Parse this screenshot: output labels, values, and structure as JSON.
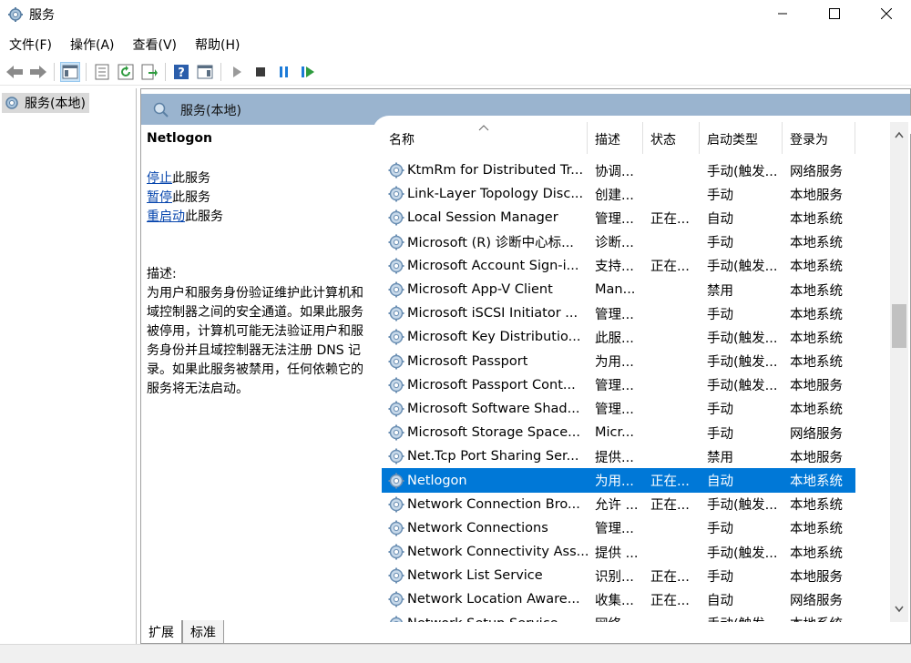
{
  "window": {
    "title": "服务"
  },
  "menu": [
    "文件(F)",
    "操作(A)",
    "查看(V)",
    "帮助(H)"
  ],
  "tree": {
    "root_label": "服务(本地)"
  },
  "panel": {
    "header_title": "服务(本地)"
  },
  "selected_service": {
    "name": "Netlogon",
    "actions": [
      {
        "link": "停止",
        "suffix": "此服务"
      },
      {
        "link": "暂停",
        "suffix": "此服务"
      },
      {
        "link": "重启动",
        "suffix": "此服务"
      }
    ],
    "description_label": "描述:",
    "description": "为用户和服务身份验证维护此计算机和域控制器之间的安全通道。如果此服务被停用，计算机可能无法验证用户和服务身份并且域控制器无法注册 DNS 记录。如果此服务被禁用，任何依赖它的服务将无法启动。"
  },
  "columns": [
    "名称",
    "描述",
    "状态",
    "启动类型",
    "登录为"
  ],
  "rows": [
    {
      "name": "KtmRm for Distributed Tr...",
      "desc": "协调...",
      "status": "",
      "startup": "手动(触发...",
      "logon": "网络服务"
    },
    {
      "name": "Link-Layer Topology Disc...",
      "desc": "创建...",
      "status": "",
      "startup": "手动",
      "logon": "本地服务"
    },
    {
      "name": "Local Session Manager",
      "desc": "管理...",
      "status": "正在...",
      "startup": "自动",
      "logon": "本地系统"
    },
    {
      "name": "Microsoft (R) 诊断中心标...",
      "desc": "诊断...",
      "status": "",
      "startup": "手动",
      "logon": "本地系统"
    },
    {
      "name": "Microsoft Account Sign-i...",
      "desc": "支持...",
      "status": "正在...",
      "startup": "手动(触发...",
      "logon": "本地系统"
    },
    {
      "name": "Microsoft App-V Client",
      "desc": "Man...",
      "status": "",
      "startup": "禁用",
      "logon": "本地系统"
    },
    {
      "name": "Microsoft iSCSI Initiator ...",
      "desc": "管理...",
      "status": "",
      "startup": "手动",
      "logon": "本地系统"
    },
    {
      "name": "Microsoft Key Distributio...",
      "desc": "此服...",
      "status": "",
      "startup": "手动(触发...",
      "logon": "本地系统"
    },
    {
      "name": "Microsoft Passport",
      "desc": "为用...",
      "status": "",
      "startup": "手动(触发...",
      "logon": "本地系统"
    },
    {
      "name": "Microsoft Passport Cont...",
      "desc": "管理...",
      "status": "",
      "startup": "手动(触发...",
      "logon": "本地服务"
    },
    {
      "name": "Microsoft Software Shad...",
      "desc": "管理...",
      "status": "",
      "startup": "手动",
      "logon": "本地系统"
    },
    {
      "name": "Microsoft Storage Space...",
      "desc": "Micr...",
      "status": "",
      "startup": "手动",
      "logon": "网络服务"
    },
    {
      "name": "Net.Tcp Port Sharing Ser...",
      "desc": "提供...",
      "status": "",
      "startup": "禁用",
      "logon": "本地服务"
    },
    {
      "name": "Netlogon",
      "desc": "为用...",
      "status": "正在...",
      "startup": "自动",
      "logon": "本地系统",
      "selected": true
    },
    {
      "name": "Network Connection Bro...",
      "desc": "允许 ...",
      "status": "正在...",
      "startup": "手动(触发...",
      "logon": "本地系统"
    },
    {
      "name": "Network Connections",
      "desc": "管理...",
      "status": "",
      "startup": "手动",
      "logon": "本地系统"
    },
    {
      "name": "Network Connectivity Ass...",
      "desc": "提供 ...",
      "status": "",
      "startup": "手动(触发...",
      "logon": "本地系统"
    },
    {
      "name": "Network List Service",
      "desc": "识别...",
      "status": "正在...",
      "startup": "手动",
      "logon": "本地服务"
    },
    {
      "name": "Network Location Aware...",
      "desc": "收集...",
      "status": "正在...",
      "startup": "自动",
      "logon": "网络服务"
    },
    {
      "name": "Network Setup Service",
      "desc": "网络...",
      "status": "",
      "startup": "手动(触发...",
      "logon": "本地系统"
    }
  ],
  "tabs": [
    "扩展",
    "标准"
  ],
  "colors": {
    "selection": "#0078d7",
    "header_band": "#9ab4cf",
    "link": "#0645ad"
  }
}
